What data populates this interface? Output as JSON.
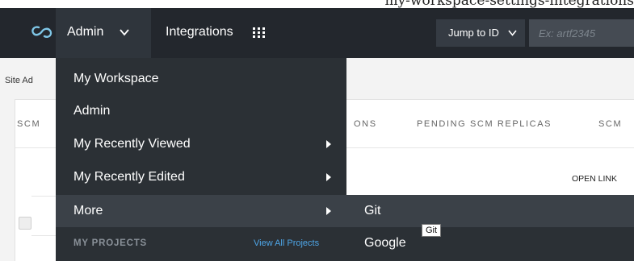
{
  "caption": {
    "text": "my-workspace-settings-integrations"
  },
  "topnav": {
    "admin_label": "Admin",
    "integrations_label": "Integrations",
    "jump_label": "Jump to ID",
    "search_placeholder": "Ex: artf2345",
    "icons": {
      "logo": "logo-icon",
      "admin_chevron": "chevron-down-icon",
      "apps": "grid-icon",
      "jump_chevron": "chevron-down-icon"
    }
  },
  "breadcrumb": {
    "text": "Site Ad"
  },
  "tabs": [
    {
      "label": "SCM"
    },
    {
      "label": "ONS"
    },
    {
      "label": "PENDING SCM REPLICAS"
    },
    {
      "label": "SCM"
    }
  ],
  "table": {
    "open_link_label": "OPEN LINK"
  },
  "admin_menu": {
    "items": [
      {
        "label": "My Workspace",
        "submenu": false
      },
      {
        "label": "Admin",
        "submenu": false
      },
      {
        "label": "My Recently Viewed",
        "submenu": true
      },
      {
        "label": "My Recently Edited",
        "submenu": true
      },
      {
        "label": "More",
        "submenu": true,
        "active": true
      }
    ],
    "projects_heading": "MY PROJECTS",
    "view_all_label": "View All Projects"
  },
  "more_submenu": {
    "items": [
      {
        "label": "Git",
        "active": true
      },
      {
        "label": "Google"
      }
    ]
  },
  "tooltip": {
    "text": "Git"
  },
  "colors": {
    "nav_bg": "#23272d",
    "menu_bg": "#2b3035",
    "menu_active": "#3b4148",
    "link_blue": "#4ea6e8",
    "logo_cyan": "#7fc6e6"
  }
}
